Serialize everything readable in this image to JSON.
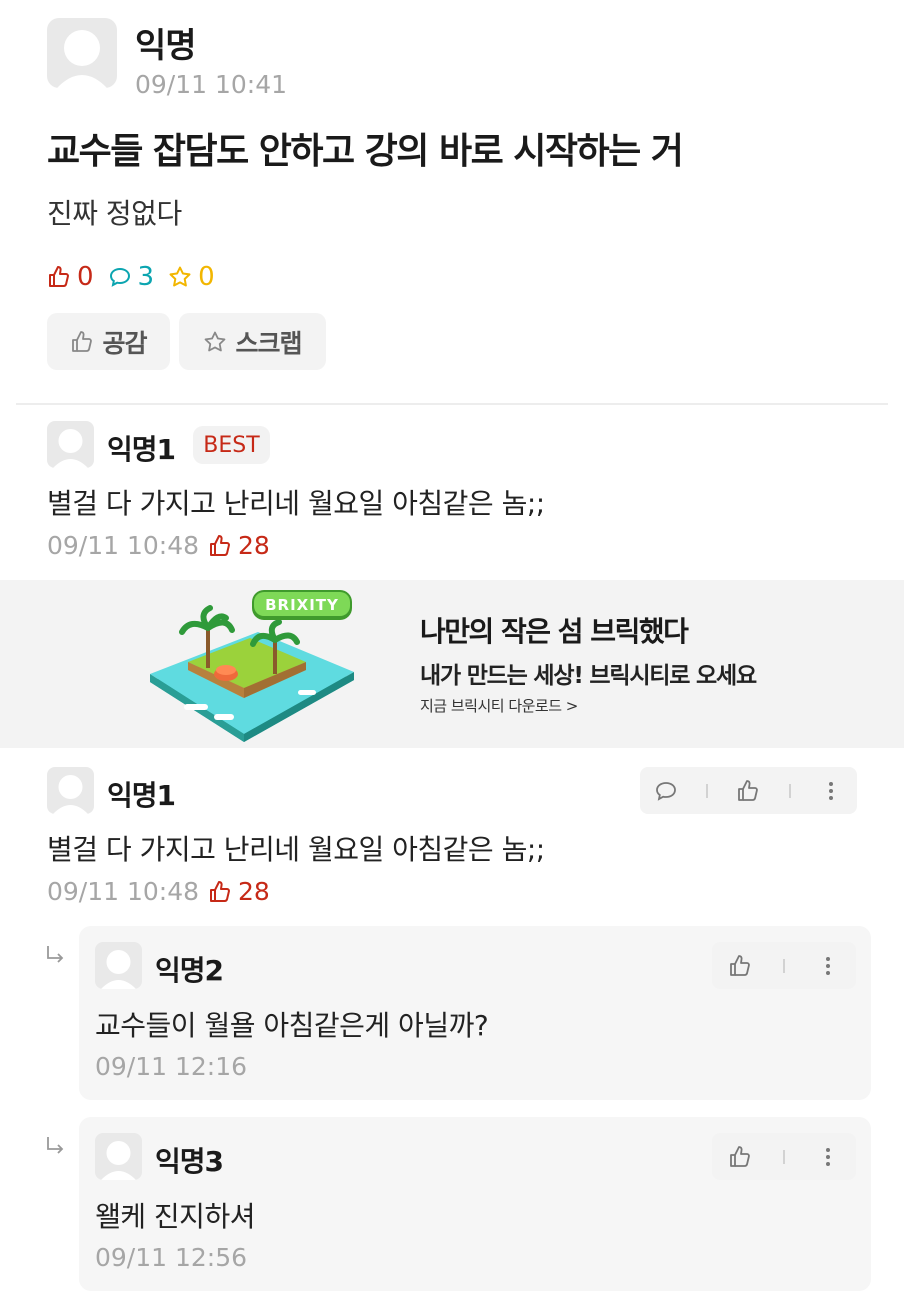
{
  "post": {
    "author": "익명",
    "time": "09/11 10:41",
    "title": "교수들 잡담도 안하고 강의 바로 시작하는 거",
    "body": "진짜 정없다",
    "stats": {
      "likes": "0",
      "comments": "3",
      "scraps": "0"
    },
    "buttons": {
      "sympathy": "공감",
      "scrap": "스크랩"
    }
  },
  "best_comment": {
    "author": "익명1",
    "badge": "BEST",
    "text": "별걸 다 가지고 난리네 월요일 아침같은 놈;;",
    "time": "09/11 10:48",
    "likes": "28"
  },
  "ad": {
    "logo": "BRIXITY",
    "title": "나만의 작은 섬 브릭했다",
    "subtitle": "내가 만드는 세상! 브릭시티로 오세요",
    "cta": "지금 브릭시티 다운로드 >"
  },
  "comments": [
    {
      "author": "익명1",
      "text": "별걸 다 가지고 난리네 월요일 아침같은 놈;;",
      "time": "09/11 10:48",
      "likes": "28",
      "replies": [
        {
          "author": "익명2",
          "text": "교수들이 월욜 아침같은게 아닐까?",
          "time": "09/11 12:16"
        },
        {
          "author": "익명3",
          "text": "왤케 진지하셔",
          "time": "09/11 12:56"
        }
      ]
    }
  ],
  "colors": {
    "like": "#c62917",
    "comment": "#0ca5b0",
    "scrap": "#f2b600",
    "meta": "#a6a6a6"
  },
  "icons": [
    "thumbs-up-icon",
    "speech-bubble-icon",
    "star-icon",
    "more-vertical-icon",
    "reply-arrow-icon",
    "avatar-icon"
  ]
}
